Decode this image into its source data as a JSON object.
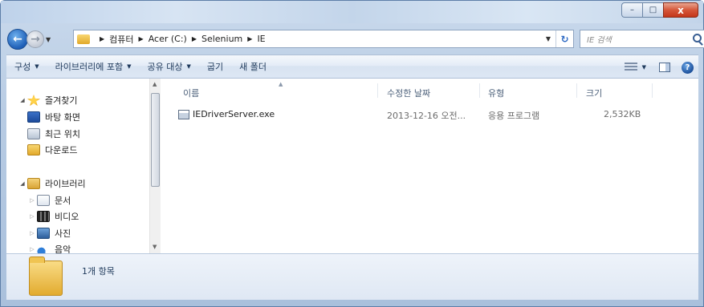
{
  "window": {
    "controls": {
      "minimize_glyph": "–",
      "maximize_glyph": "□",
      "close_glyph": "x"
    }
  },
  "nav": {
    "back_glyph": "←",
    "forward_glyph": "→"
  },
  "address": {
    "breadcrumbs": [
      "컴퓨터",
      "Acer (C:)",
      "Selenium",
      "IE"
    ],
    "refresh_glyph": "↻"
  },
  "search": {
    "placeholder": "IE 검색",
    "icon": "search-icon"
  },
  "commandbar": {
    "items": [
      "구성",
      "라이브러리에 포함",
      "공유 대상",
      "굽기",
      "새 폴더"
    ]
  },
  "sidebar": {
    "favorites": {
      "label": "즐겨찾기",
      "items": [
        {
          "label": "바탕 화면",
          "icon": "desktop-icon"
        },
        {
          "label": "최근 위치",
          "icon": "recent-places-icon"
        },
        {
          "label": "다운로드",
          "icon": "downloads-icon"
        }
      ]
    },
    "libraries": {
      "label": "라이브러리",
      "items": [
        {
          "label": "문서",
          "icon": "documents-icon"
        },
        {
          "label": "비디오",
          "icon": "video-icon"
        },
        {
          "label": "사진",
          "icon": "pictures-icon"
        },
        {
          "label": "음악",
          "icon": "music-icon"
        }
      ]
    }
  },
  "columns": [
    "이름",
    "수정한 날짜",
    "유형",
    "크기"
  ],
  "files": [
    {
      "name": "IEDriverServer.exe",
      "modified": "2013-12-16 오전...",
      "type": "응용 프로그램",
      "size": "2,532KB"
    }
  ],
  "details": {
    "item_count": "1개 항목"
  },
  "colors": {
    "accent": "#1e5fb7",
    "close": "#c4361b",
    "folder": "#e1a92a"
  }
}
